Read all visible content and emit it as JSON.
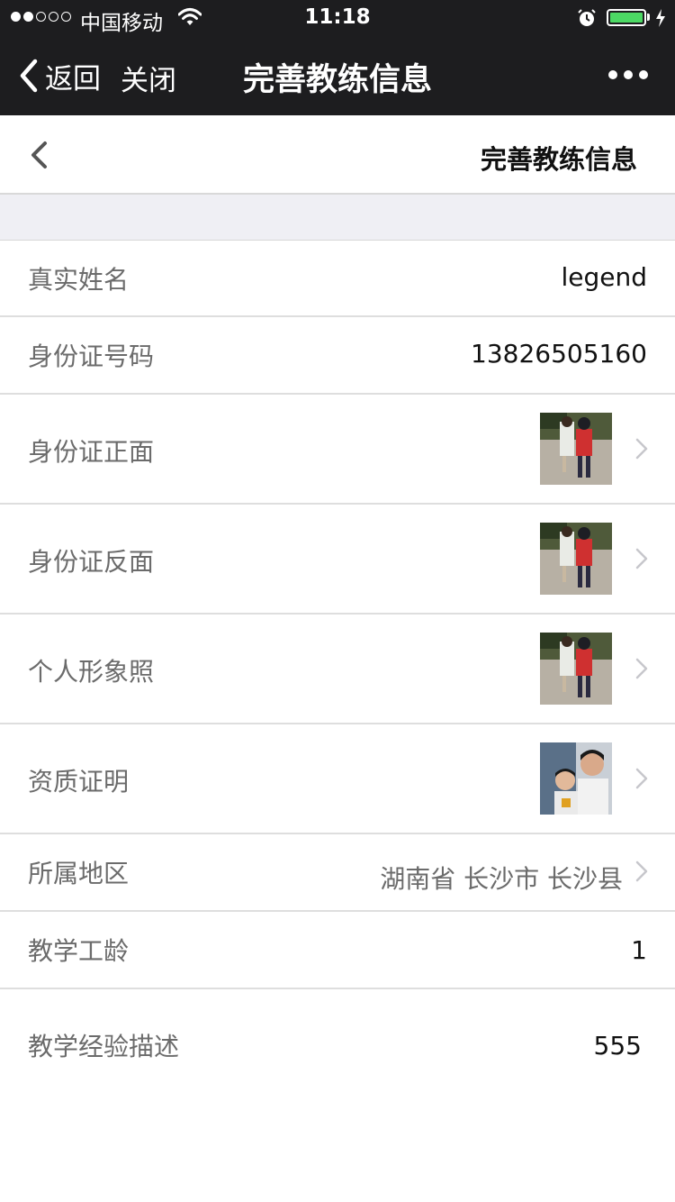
{
  "status_bar": {
    "carrier": "中国移动",
    "time": "11:18",
    "signal_icon": "signal-dots-icon",
    "wifi_icon": "wifi-icon",
    "alarm_icon": "alarm-clock-icon",
    "battery_icon": "battery-icon",
    "battery_level": 1.0,
    "charging_icon": "charging-bolt-icon"
  },
  "wechat_nav": {
    "back_label": "返回",
    "close_label": "关闭",
    "title": "完善教练信息",
    "more_icon": "more-dots-icon"
  },
  "page_header": {
    "back_icon": "chevron-left-icon",
    "title": "完善教练信息"
  },
  "colors": {
    "nav_background": "#1d1d1f",
    "battery": "#4cd964",
    "separator_band": "#efeff4",
    "label_text": "#6b6b6b",
    "value_text": "#111111"
  },
  "form": {
    "real_name": {
      "label": "真实姓名",
      "value": "legend"
    },
    "id_number": {
      "label": "身份证号码",
      "value": "13826505160"
    },
    "id_front": {
      "label": "身份证正面",
      "thumbnail": "photo-thumbnail",
      "chevron": "chevron-right-icon"
    },
    "id_back": {
      "label": "身份证反面",
      "thumbnail": "photo-thumbnail",
      "chevron": "chevron-right-icon"
    },
    "portrait": {
      "label": "个人形象照",
      "thumbnail": "photo-thumbnail",
      "chevron": "chevron-right-icon"
    },
    "certificate": {
      "label": "资质证明",
      "thumbnail": "photo-thumbnail",
      "chevron": "chevron-right-icon"
    },
    "region": {
      "label": "所属地区",
      "value": "湖南省 长沙市 长沙县",
      "chevron": "chevron-right-icon"
    },
    "years": {
      "label": "教学工龄",
      "value": "1"
    },
    "experience": {
      "label": "教学经验描述",
      "value": "555"
    }
  }
}
